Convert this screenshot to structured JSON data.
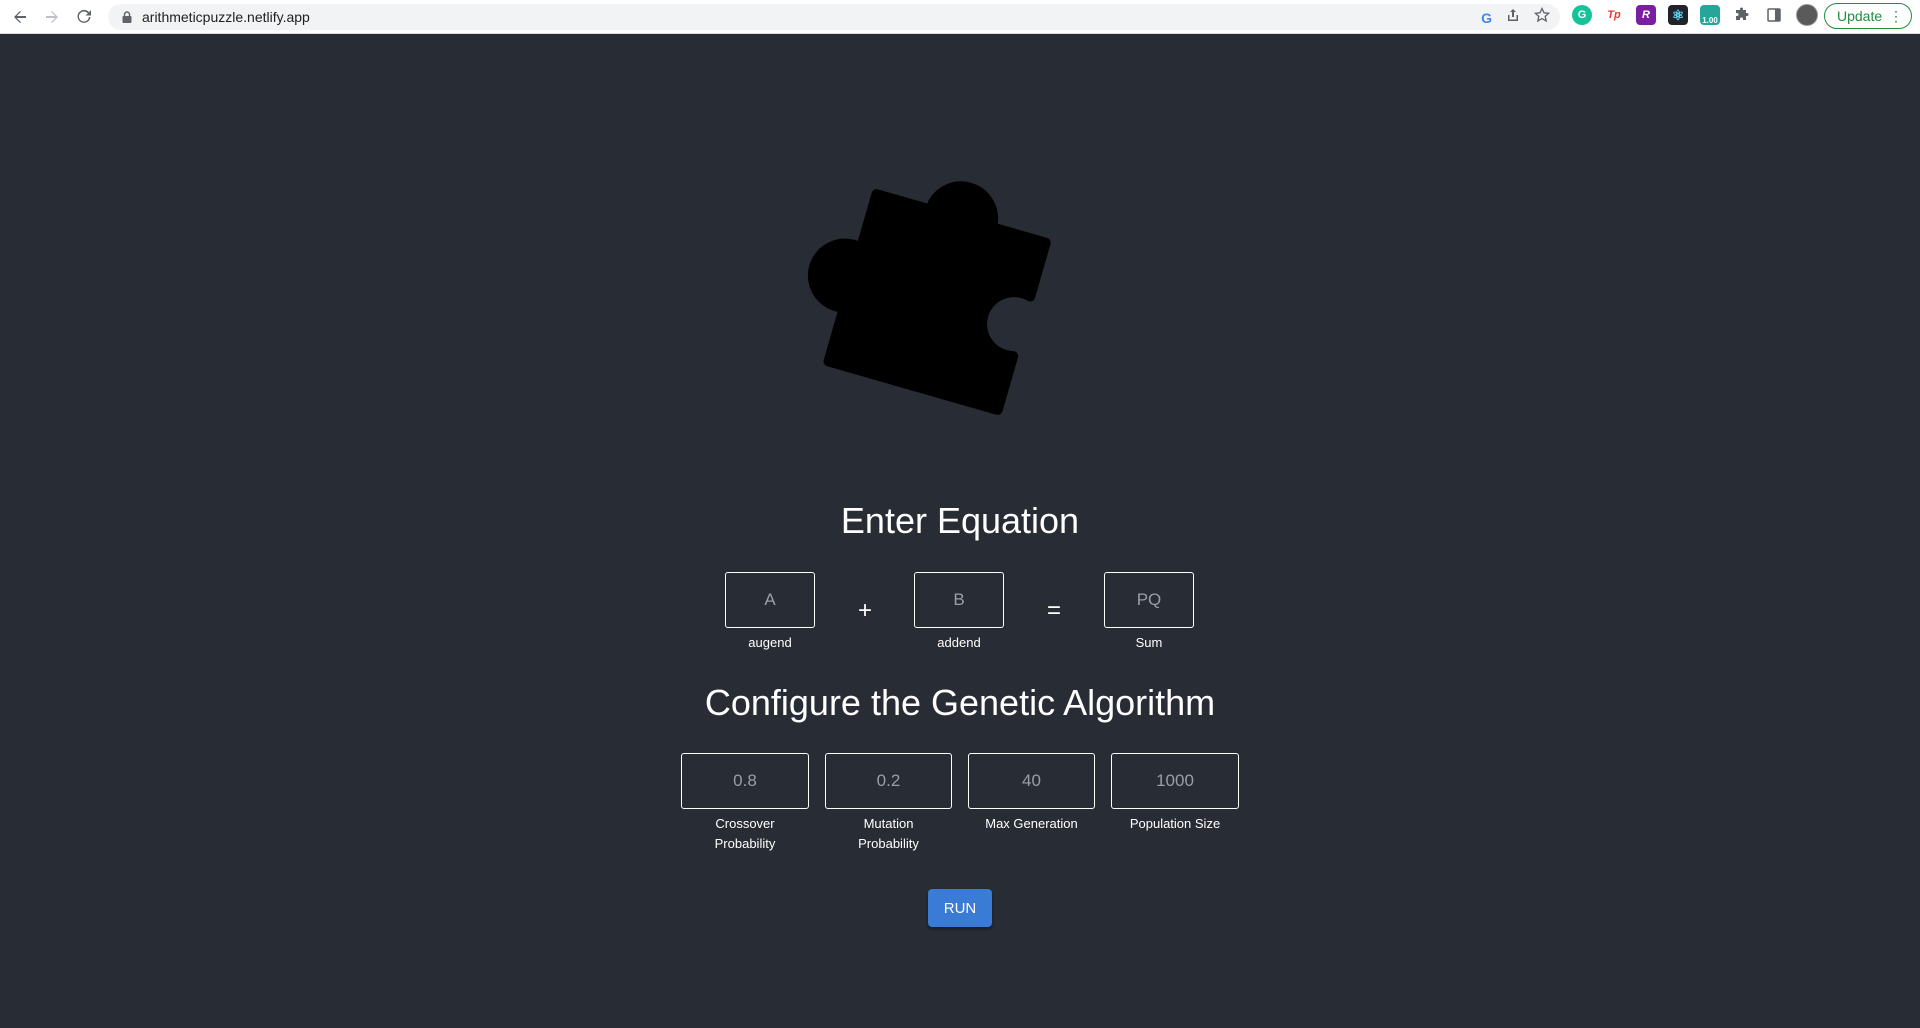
{
  "browser": {
    "url": "arithmeticpuzzle.netlify.app",
    "update_label": "Update",
    "extensions": [
      {
        "name": "grammarly-icon",
        "text": "G",
        "color": "#15c39a"
      },
      {
        "name": "tp-extension-icon",
        "text": "Tp",
        "color": "#ffffff"
      },
      {
        "name": "r-extension-icon",
        "text": "R",
        "color": "#7b1fa2"
      },
      {
        "name": "react-devtools-icon",
        "text": "⚛",
        "color": "#20232a"
      },
      {
        "name": "speed-extension-icon",
        "text": "1.00",
        "color": "#26a69a"
      }
    ]
  },
  "equation": {
    "title": "Enter Equation",
    "plus": "+",
    "equals": "=",
    "augend": {
      "placeholder": "A",
      "label": "augend"
    },
    "addend": {
      "placeholder": "B",
      "label": "addend"
    },
    "sum": {
      "placeholder": "PQ",
      "label": "Sum"
    }
  },
  "config": {
    "title": "Configure the Genetic Algorithm",
    "fields": [
      {
        "placeholder": "0.8",
        "label_line1": "Crossover",
        "label_line2": "Probability"
      },
      {
        "placeholder": "0.2",
        "label_line1": "Mutation",
        "label_line2": "Probability"
      },
      {
        "placeholder": "40",
        "label_line1": "Max Generation",
        "label_line2": ""
      },
      {
        "placeholder": "1000",
        "label_line1": "Population Size",
        "label_line2": ""
      }
    ]
  },
  "run_label": "RUN",
  "colors": {
    "background": "#282c34",
    "button": "#3a7bd5",
    "logo": "#000000"
  }
}
